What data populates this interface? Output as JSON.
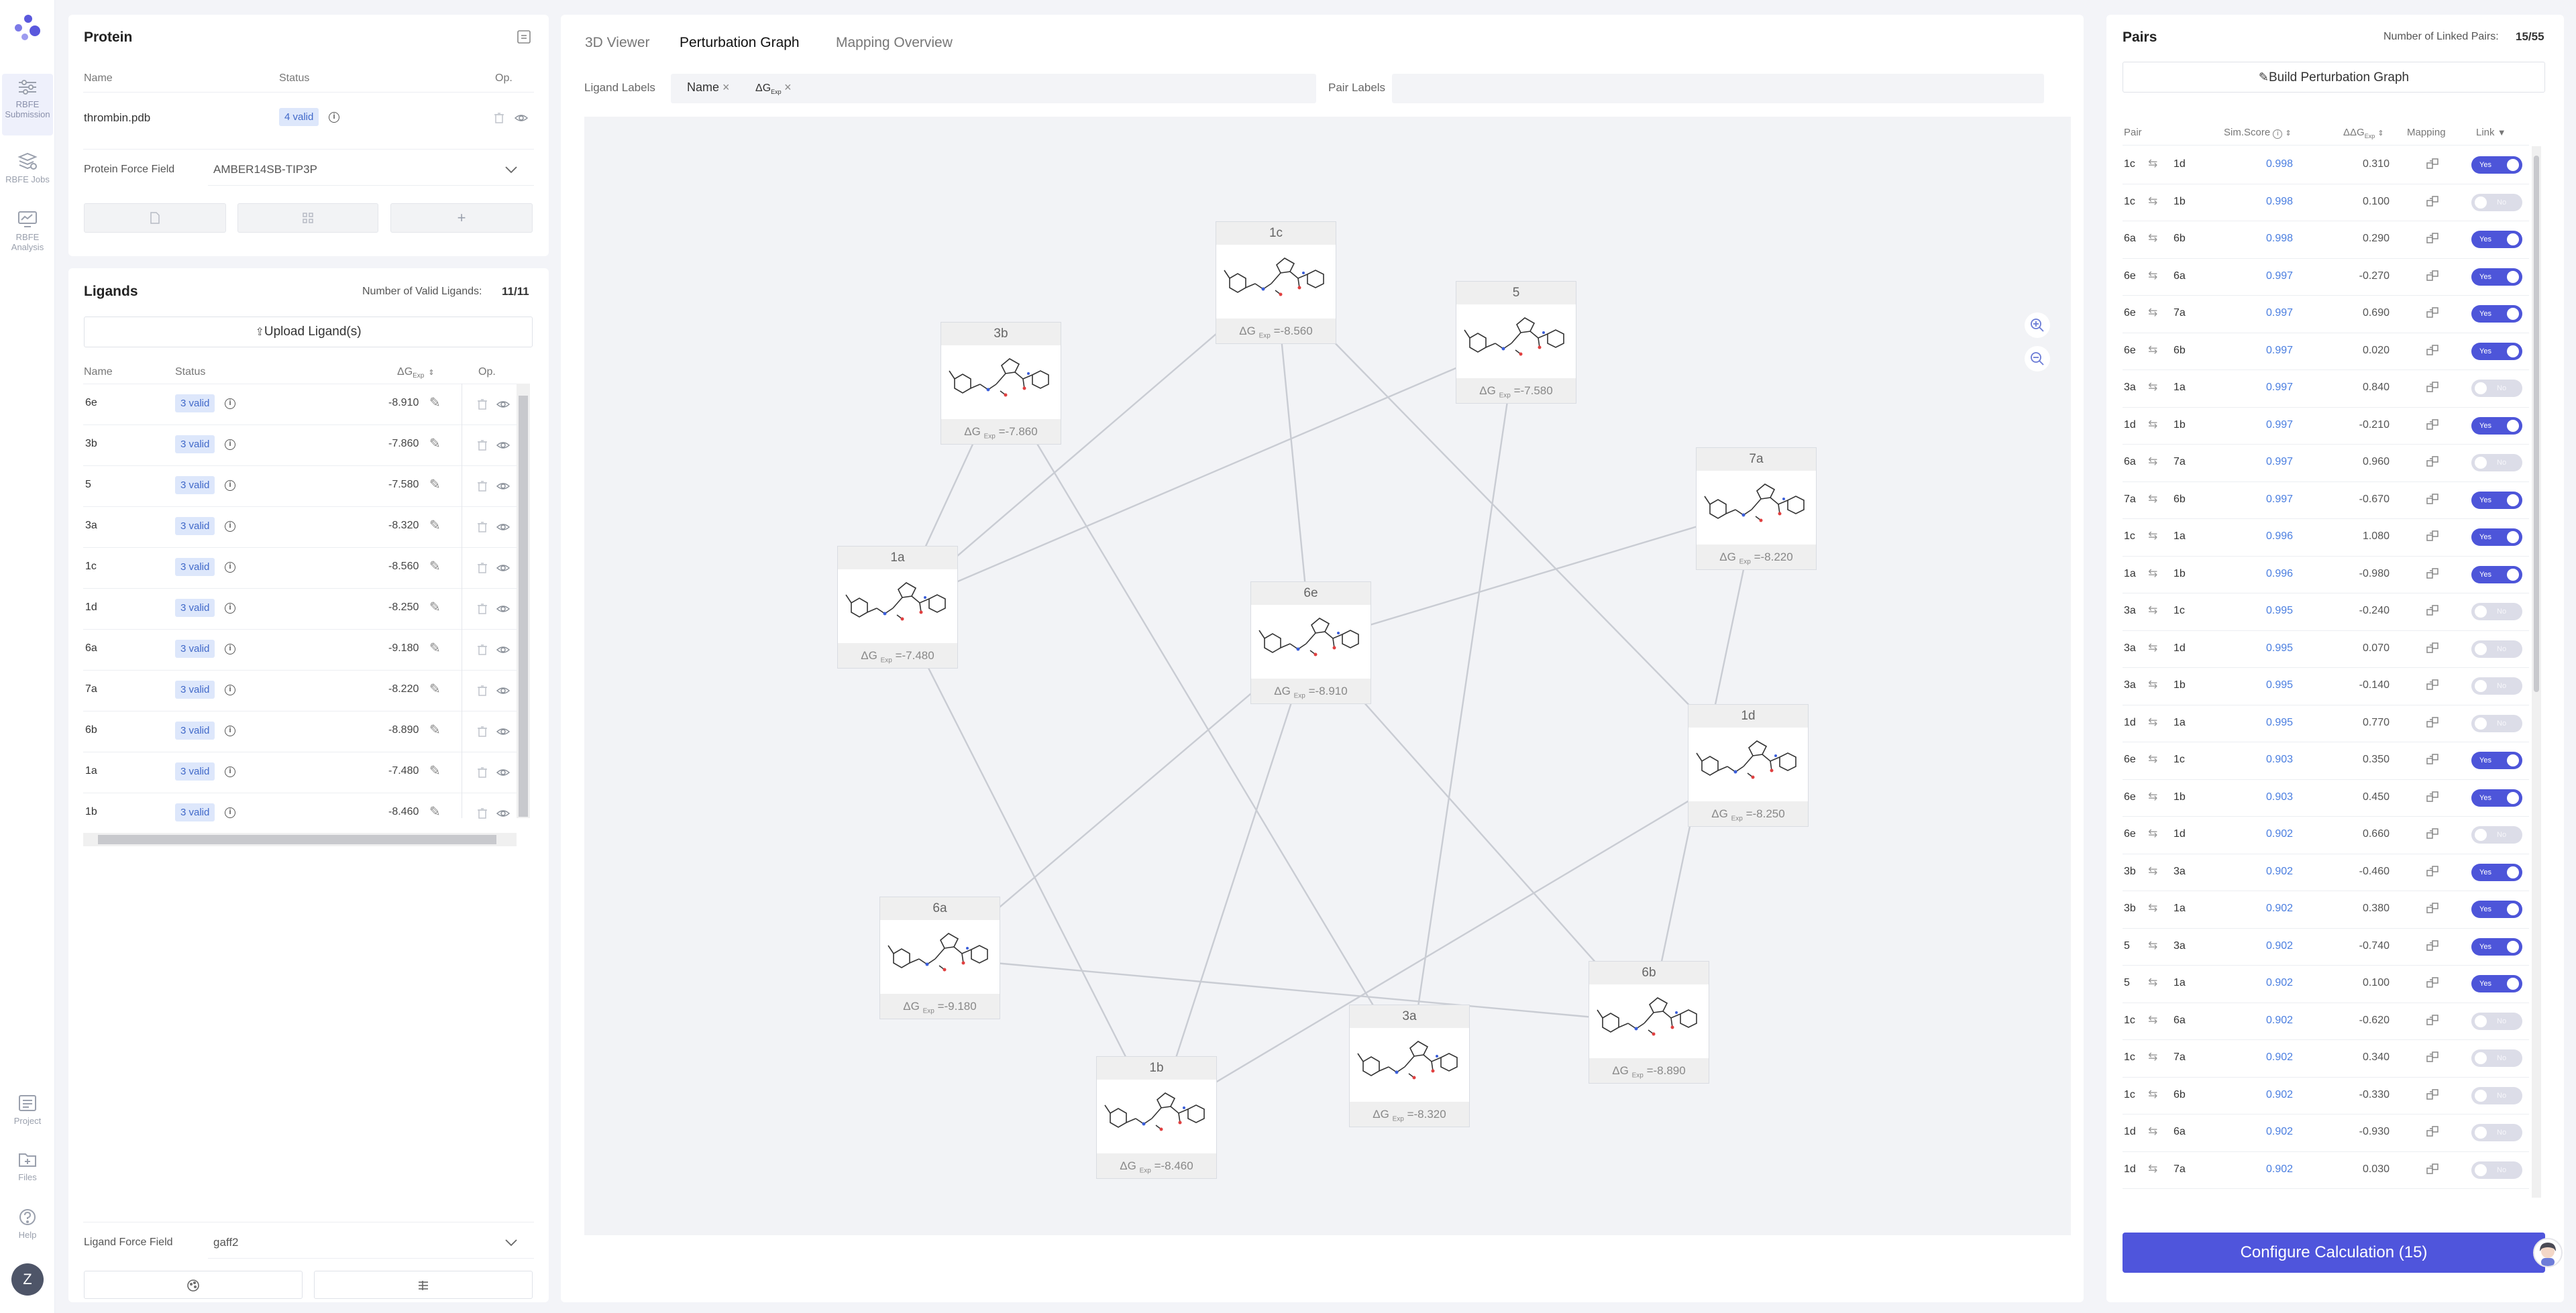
{
  "sidebar": {
    "items": [
      {
        "label": "RBFE Submission",
        "line1": "RBFE",
        "line2": "Submission",
        "icon": "sliders-icon"
      },
      {
        "label": "RBFE Jobs",
        "line1": "RBFE Jobs",
        "line2": "",
        "icon": "jobs-icon"
      },
      {
        "label": "RBFE Analysis",
        "line1": "RBFE",
        "line2": "Analysis",
        "icon": "monitor-icon"
      }
    ],
    "bottom": [
      {
        "label": "Project",
        "icon": "project-icon"
      },
      {
        "label": "Files",
        "icon": "folder-icon"
      },
      {
        "label": "Help",
        "icon": "help-icon"
      }
    ],
    "avatar": "Z"
  },
  "protein": {
    "title": "Protein",
    "col_name": "Name",
    "col_status": "Status",
    "col_op": "Op.",
    "file": "thrombin.pdb",
    "status": "4 valid",
    "force_field_label": "Protein Force Field",
    "force_field_value": "AMBER14SB-TIP3P",
    "add_symbol": "+"
  },
  "ligands": {
    "title": "Ligands",
    "valid_label": "Number of Valid Ligands:",
    "valid_count": "11/11",
    "upload": "Upload Ligand(s)",
    "col_name": "Name",
    "col_status": "Status",
    "col_dg": "ΔG",
    "col_dg_sub": "Exp",
    "col_op": "Op.",
    "rows": [
      {
        "name": "6e",
        "status": "3 valid",
        "dg": "-8.910"
      },
      {
        "name": "3b",
        "status": "3 valid",
        "dg": "-7.860"
      },
      {
        "name": "5",
        "status": "3 valid",
        "dg": "-7.580"
      },
      {
        "name": "3a",
        "status": "3 valid",
        "dg": "-8.320"
      },
      {
        "name": "1c",
        "status": "3 valid",
        "dg": "-8.560"
      },
      {
        "name": "1d",
        "status": "3 valid",
        "dg": "-8.250"
      },
      {
        "name": "6a",
        "status": "3 valid",
        "dg": "-9.180"
      },
      {
        "name": "7a",
        "status": "3 valid",
        "dg": "-8.220"
      },
      {
        "name": "6b",
        "status": "3 valid",
        "dg": "-8.890"
      },
      {
        "name": "1a",
        "status": "3 valid",
        "dg": "-7.480"
      },
      {
        "name": "1b",
        "status": "3 valid",
        "dg": "-8.460"
      }
    ],
    "force_field_label": "Ligand Force Field",
    "force_field_value": "gaff2"
  },
  "center": {
    "tabs": [
      "3D Viewer",
      "Perturbation Graph",
      "Mapping Overview"
    ],
    "active_tab": 1,
    "ligand_labels_label": "Ligand Labels",
    "chips": [
      {
        "label": "Name",
        "sub": ""
      },
      {
        "label": "ΔG",
        "sub": "Exp"
      }
    ],
    "chip_close": "×",
    "pair_labels_label": "Pair Labels",
    "zoom_in": "+",
    "zoom_out": "−"
  },
  "graph": {
    "dg_prefix": "ΔG",
    "dg_sub": "Exp",
    "nodes": [
      {
        "id": "1c",
        "dg": "-8.560"
      },
      {
        "id": "3b",
        "dg": "-7.860"
      },
      {
        "id": "5",
        "dg": "-7.580"
      },
      {
        "id": "7a",
        "dg": "-8.220"
      },
      {
        "id": "1a",
        "dg": "-7.480"
      },
      {
        "id": "6e",
        "dg": "-8.910"
      },
      {
        "id": "1d",
        "dg": "-8.250"
      },
      {
        "id": "6a",
        "dg": "-9.180"
      },
      {
        "id": "6b",
        "dg": "-8.890"
      },
      {
        "id": "3a",
        "dg": "-8.320"
      },
      {
        "id": "1b",
        "dg": "-8.460"
      }
    ],
    "edges": [
      [
        "1c",
        "1d"
      ],
      [
        "6a",
        "6b"
      ],
      [
        "6e",
        "6a"
      ],
      [
        "6e",
        "7a"
      ],
      [
        "6e",
        "6b"
      ],
      [
        "1d",
        "1b"
      ],
      [
        "7a",
        "6b"
      ],
      [
        "1c",
        "1a"
      ],
      [
        "1a",
        "1b"
      ],
      [
        "6e",
        "1c"
      ],
      [
        "6e",
        "1b"
      ],
      [
        "3b",
        "3a"
      ],
      [
        "3b",
        "1a"
      ],
      [
        "5",
        "3a"
      ],
      [
        "5",
        "1a"
      ]
    ]
  },
  "pairs": {
    "title": "Pairs",
    "linked_label": "Number of Linked Pairs:",
    "linked_count": "15/55",
    "build": "Build Perturbation Graph",
    "col_pair": "Pair",
    "col_score": "Sim.Score",
    "col_ddg": "ΔΔG",
    "col_ddg_sub": "Exp",
    "col_mapping": "Mapping",
    "col_link": "Link",
    "yes": "Yes",
    "no": "No",
    "rows": [
      {
        "a": "1c",
        "b": "1d",
        "score": "0.998",
        "ddg": "0.310",
        "link": true
      },
      {
        "a": "1c",
        "b": "1b",
        "score": "0.998",
        "ddg": "0.100",
        "link": false
      },
      {
        "a": "6a",
        "b": "6b",
        "score": "0.998",
        "ddg": "0.290",
        "link": true
      },
      {
        "a": "6e",
        "b": "6a",
        "score": "0.997",
        "ddg": "-0.270",
        "link": true
      },
      {
        "a": "6e",
        "b": "7a",
        "score": "0.997",
        "ddg": "0.690",
        "link": true
      },
      {
        "a": "6e",
        "b": "6b",
        "score": "0.997",
        "ddg": "0.020",
        "link": true
      },
      {
        "a": "3a",
        "b": "1a",
        "score": "0.997",
        "ddg": "0.840",
        "link": false
      },
      {
        "a": "1d",
        "b": "1b",
        "score": "0.997",
        "ddg": "-0.210",
        "link": true
      },
      {
        "a": "6a",
        "b": "7a",
        "score": "0.997",
        "ddg": "0.960",
        "link": false
      },
      {
        "a": "7a",
        "b": "6b",
        "score": "0.997",
        "ddg": "-0.670",
        "link": true
      },
      {
        "a": "1c",
        "b": "1a",
        "score": "0.996",
        "ddg": "1.080",
        "link": true
      },
      {
        "a": "1a",
        "b": "1b",
        "score": "0.996",
        "ddg": "-0.980",
        "link": true
      },
      {
        "a": "3a",
        "b": "1c",
        "score": "0.995",
        "ddg": "-0.240",
        "link": false
      },
      {
        "a": "3a",
        "b": "1d",
        "score": "0.995",
        "ddg": "0.070",
        "link": false
      },
      {
        "a": "3a",
        "b": "1b",
        "score": "0.995",
        "ddg": "-0.140",
        "link": false
      },
      {
        "a": "1d",
        "b": "1a",
        "score": "0.995",
        "ddg": "0.770",
        "link": false
      },
      {
        "a": "6e",
        "b": "1c",
        "score": "0.903",
        "ddg": "0.350",
        "link": true
      },
      {
        "a": "6e",
        "b": "1b",
        "score": "0.903",
        "ddg": "0.450",
        "link": true
      },
      {
        "a": "6e",
        "b": "1d",
        "score": "0.902",
        "ddg": "0.660",
        "link": false
      },
      {
        "a": "3b",
        "b": "3a",
        "score": "0.902",
        "ddg": "-0.460",
        "link": true
      },
      {
        "a": "3b",
        "b": "1a",
        "score": "0.902",
        "ddg": "0.380",
        "link": true
      },
      {
        "a": "5",
        "b": "3a",
        "score": "0.902",
        "ddg": "-0.740",
        "link": true
      },
      {
        "a": "5",
        "b": "1a",
        "score": "0.902",
        "ddg": "0.100",
        "link": true
      },
      {
        "a": "1c",
        "b": "6a",
        "score": "0.902",
        "ddg": "-0.620",
        "link": false
      },
      {
        "a": "1c",
        "b": "7a",
        "score": "0.902",
        "ddg": "0.340",
        "link": false
      },
      {
        "a": "1c",
        "b": "6b",
        "score": "0.902",
        "ddg": "-0.330",
        "link": false
      },
      {
        "a": "1d",
        "b": "6a",
        "score": "0.902",
        "ddg": "-0.930",
        "link": false
      },
      {
        "a": "1d",
        "b": "7a",
        "score": "0.902",
        "ddg": "0.030",
        "link": false
      }
    ],
    "configure": "Configure Calculation (15)"
  },
  "colors": {
    "accent": "#4f55dc",
    "link_blue": "#4a7ee0",
    "tag_bg": "#dde7fb"
  }
}
